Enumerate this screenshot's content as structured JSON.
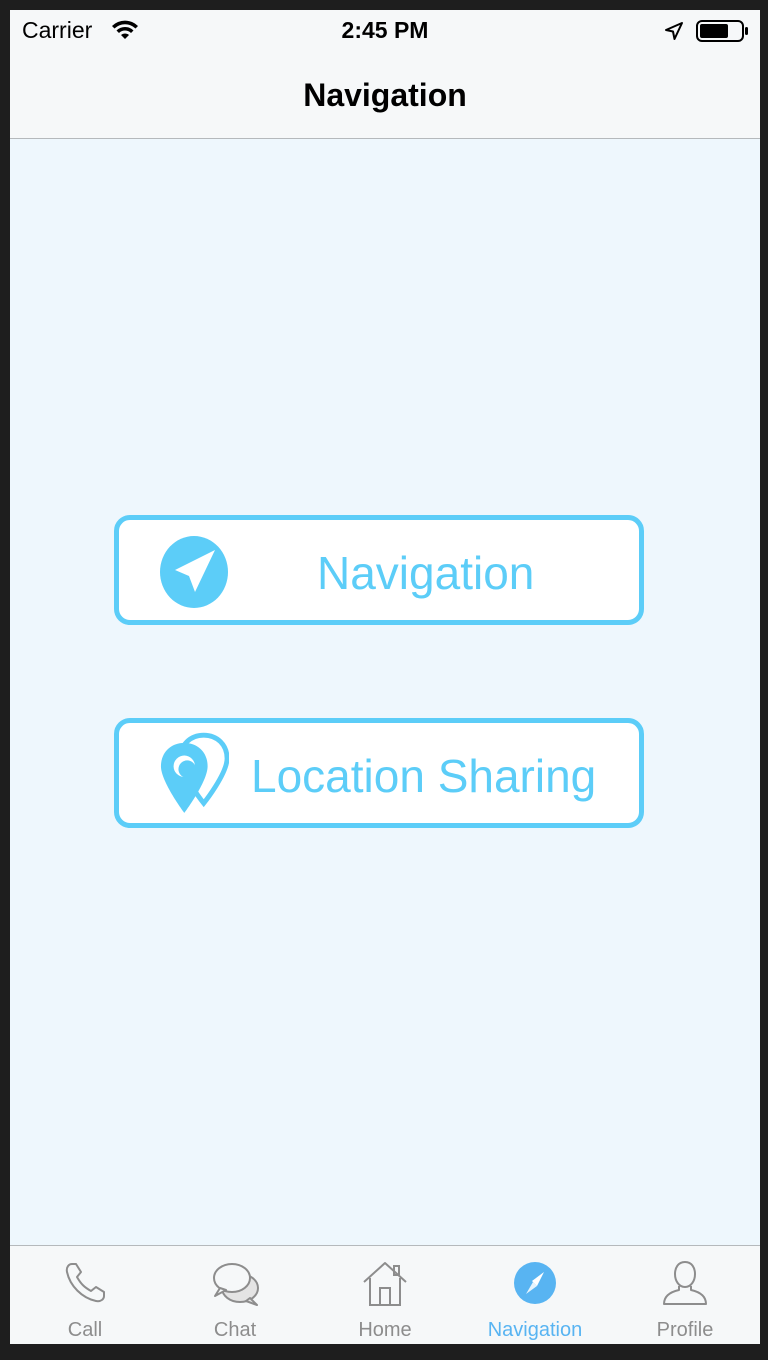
{
  "status_bar": {
    "carrier": "Carrier",
    "time": "2:45 PM",
    "icons": [
      "wifi-icon",
      "location-arrow-icon",
      "battery-icon"
    ]
  },
  "nav_bar": {
    "title": "Navigation"
  },
  "actions": [
    {
      "label": "Navigation",
      "icon": "navigation-arrow-icon"
    },
    {
      "label": "Location Sharing",
      "icon": "location-pin-icon"
    }
  ],
  "tab_bar": {
    "tabs": [
      {
        "label": "Call",
        "icon": "phone-icon"
      },
      {
        "label": "Chat",
        "icon": "chat-bubbles-icon"
      },
      {
        "label": "Home",
        "icon": "home-icon"
      },
      {
        "label": "Navigation",
        "icon": "compass-icon",
        "active": true
      },
      {
        "label": "Profile",
        "icon": "profile-icon"
      }
    ]
  },
  "colors": {
    "accent": "#5ccdf8",
    "tab_active": "#58b4f2",
    "tab_inactive": "#8d8d8d",
    "background": "#eef7fd"
  }
}
